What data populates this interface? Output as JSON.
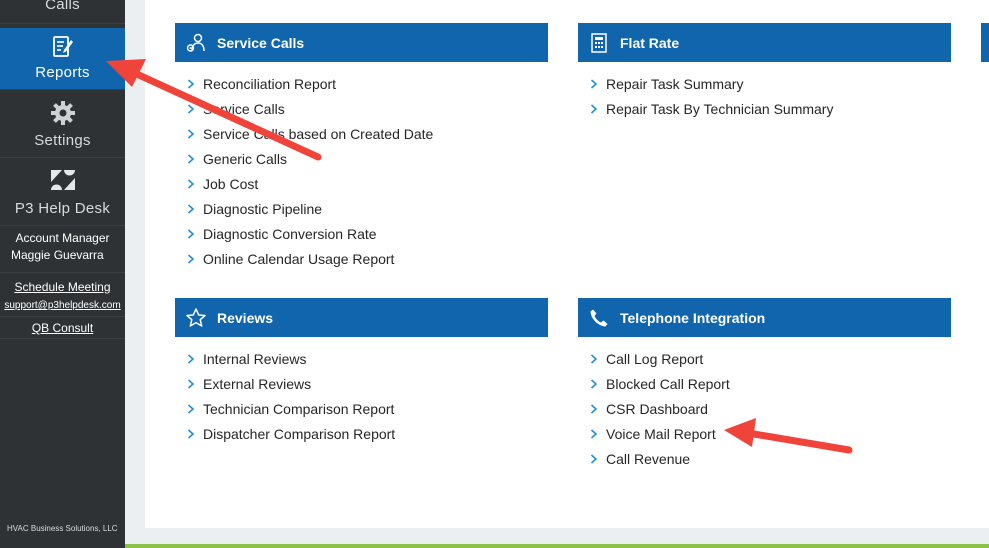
{
  "sidebar": {
    "calls_label": "Calls",
    "reports_label": "Reports",
    "settings_label": "Settings",
    "helpdesk_label": "P3 Help Desk",
    "account_manager_title": "Account Manager",
    "account_manager_name": "Maggie Guevarra",
    "schedule_meeting": "Schedule Meeting",
    "support_email": "support@p3helpdesk.com",
    "qb_consult": "QB Consult",
    "footer": "HVAC Business Solutions, LLC"
  },
  "panels": {
    "service_calls": {
      "title": "Service Calls",
      "items": [
        "Reconciliation Report",
        "Service Calls",
        "Service Calls based on Created Date",
        "Generic Calls",
        "Job Cost",
        "Diagnostic Pipeline",
        "Diagnostic Conversion Rate",
        "Online Calendar Usage Report"
      ]
    },
    "flat_rate": {
      "title": "Flat Rate",
      "items": [
        "Repair Task Summary",
        "Repair Task By Technician Summary"
      ]
    },
    "reviews": {
      "title": "Reviews",
      "items": [
        "Internal Reviews",
        "External Reviews",
        "Technician Comparison Report",
        "Dispatcher Comparison Report"
      ]
    },
    "telephone": {
      "title": "Telephone Integration",
      "items": [
        "Call Log Report",
        "Blocked Call Report",
        "CSR Dashboard",
        "Voice Mail Report",
        "Call Revenue"
      ]
    }
  },
  "colors": {
    "accent": "#1165ad",
    "sidebar_bg": "#2f3235",
    "annotation_arrow": "#f0433a",
    "chevron": "#1f8fd6"
  },
  "icons": {
    "reports": "report-edit-icon",
    "settings": "gear-icon",
    "helpdesk": "zendesk-logo-icon",
    "service_calls": "technician-gear-icon",
    "flat_rate": "price-sheet-icon",
    "reviews": "star-outline-icon",
    "telephone": "phone-icon",
    "list": "chevron-right-icon"
  }
}
